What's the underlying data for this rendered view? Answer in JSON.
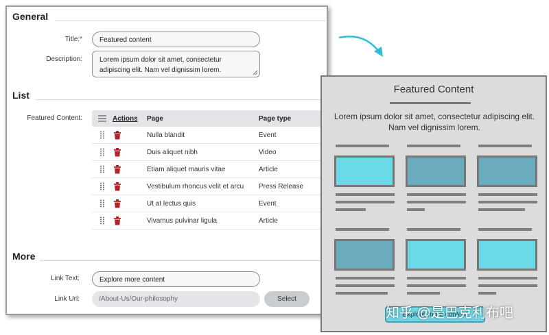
{
  "general": {
    "heading": "General",
    "title_label": "Title:",
    "title_required_mark": "*",
    "title_value": "Featured content",
    "description_label": "Description:",
    "description_value": "Lorem ipsum dolor sit amet, consectetur adipiscing elit. Nam vel dignissim lorem."
  },
  "list": {
    "heading": "List",
    "featured_label": "Featured Content:",
    "columns": {
      "actions": "Actions",
      "page": "Page",
      "page_type": "Page type"
    },
    "rows": [
      {
        "page": "Nulla blandit",
        "type": "Event"
      },
      {
        "page": "Duis aliquet nibh",
        "type": "Video"
      },
      {
        "page": "Etiam aliquet mauris vitae",
        "type": "Article"
      },
      {
        "page": "Vestibulum rhoncus velit et arcu",
        "type": "Press Release"
      },
      {
        "page": "Ut at lectus quis",
        "type": "Event"
      },
      {
        "page": "Vivamus pulvinar ligula",
        "type": "Article"
      }
    ]
  },
  "more": {
    "heading": "More",
    "link_text_label": "Link Text:",
    "link_text_value": "Explore more content",
    "link_url_label": "Link Url:",
    "link_url_value": "/About-Us/Our-philosophy",
    "select_button": "Select"
  },
  "preview": {
    "title": "Featured Content",
    "description": "Lorem ipsum dolor sit amet, consectetur adipiscing elit. Nam vel dignissim lorem.",
    "button_label": "Explore more content"
  },
  "watermark": "知乎 @是巴克利布吧",
  "colors": {
    "delete_icon": "#b3242a",
    "card_light": "#6ad9e8",
    "card_dark": "#6aabbd",
    "arrow": "#2bbfd6"
  }
}
